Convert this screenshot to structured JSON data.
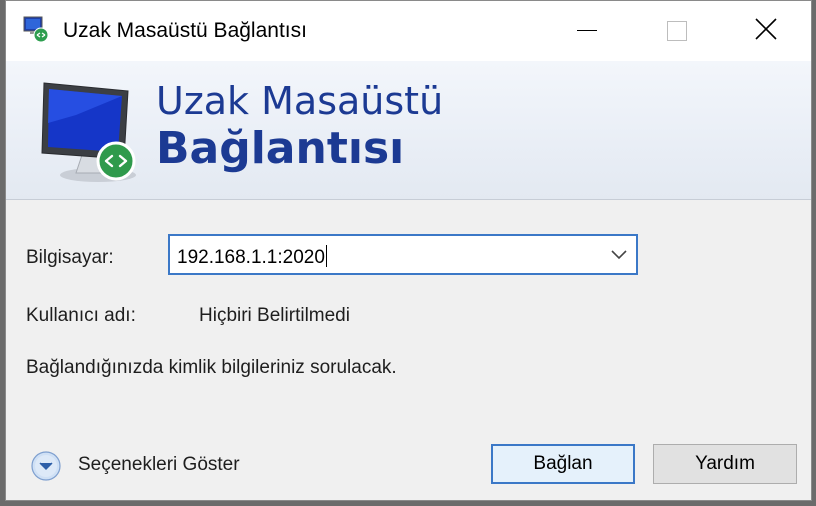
{
  "window": {
    "title": "Uzak Masaüstü Bağlantısı"
  },
  "banner": {
    "line1": "Uzak Masaüstü",
    "line2": "Bağlantısı"
  },
  "form": {
    "computer_label": "Bilgisayar:",
    "computer_value": "192.168.1.1:2020",
    "username_label": "Kullanıcı adı:",
    "username_value": "Hiçbiri Belirtilmedi",
    "info_text": "Bağlandığınızda kimlik bilgileriniz sorulacak."
  },
  "footer": {
    "show_options_label": "Seçenekleri Göster",
    "connect_label": "Bağlan",
    "help_label": "Yardım"
  },
  "colors": {
    "accent_blue": "#3b78c7",
    "banner_title": "#1c3a93",
    "window_bg": "#f0f0f0"
  },
  "icons": {
    "app": "remote-desktop-icon",
    "monitor": "remote-desktop-monitor-icon",
    "dropdown": "chevron-down-icon",
    "options": "expand-options-icon",
    "close": "close-icon",
    "minimize": "minimize-icon",
    "maximize": "maximize-icon"
  }
}
